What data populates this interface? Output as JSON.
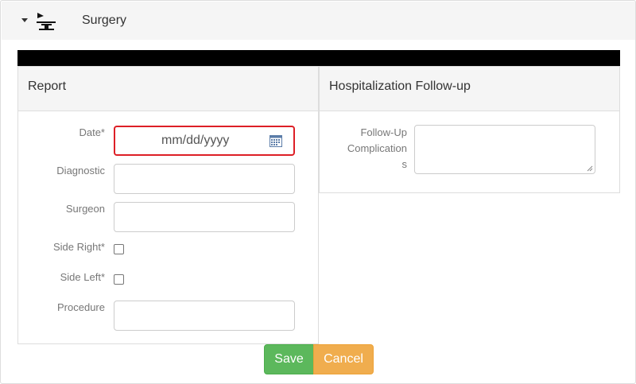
{
  "header": {
    "title": "Surgery",
    "toggle_icon": "caret-down-icon",
    "section_icon": "surgery-table-icon"
  },
  "report": {
    "title": "Report",
    "fields": {
      "date": {
        "label": "Date*",
        "placeholder": "mm/dd/yyyy",
        "icon": "calendar-icon",
        "value": ""
      },
      "diagnostic": {
        "label": "Diagnostic",
        "value": ""
      },
      "surgeon": {
        "label": "Surgeon",
        "value": ""
      },
      "side_right": {
        "label": "Side Right*",
        "checked": false
      },
      "side_left": {
        "label": "Side Left*",
        "checked": false
      },
      "procedure": {
        "label": "Procedure",
        "value": ""
      }
    }
  },
  "followup": {
    "title": "Hospitalization Follow-up",
    "fields": {
      "complications": {
        "label_lines": [
          "Follow-Up",
          "Complication",
          "s"
        ],
        "value": ""
      }
    }
  },
  "actions": {
    "save_label": "Save",
    "cancel_label": "Cancel"
  },
  "colors": {
    "save": "#5cb85c",
    "cancel": "#f0ad4e",
    "error_border": "#dd1f26",
    "panel_heading": "#f5f5f5"
  }
}
